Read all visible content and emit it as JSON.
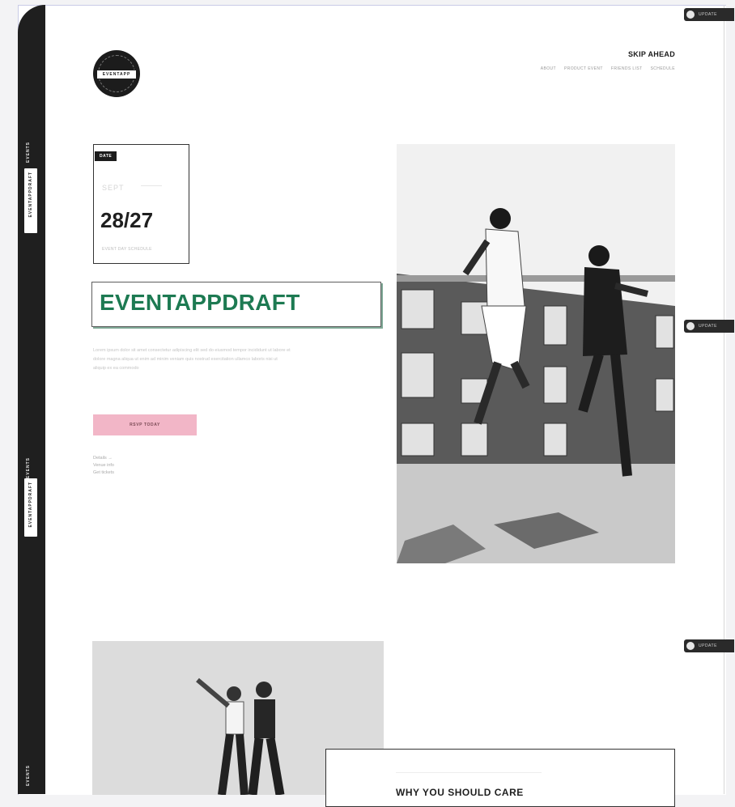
{
  "rail": {
    "vertical_text_top": "EVENTS",
    "vertical_box_top": "EVENTAPPDRAFT",
    "vertical_text_mid": "EVENTS",
    "vertical_box_mid": "EVENTAPPDRAFT",
    "vertical_text_bottom": "EVENTS"
  },
  "logo": {
    "text": "EVENTAPP"
  },
  "header": {
    "skip_label": "SKIP AHEAD",
    "nav": [
      "ABOUT",
      "PRODUCT EVENT",
      "FRIENDS LIST",
      "SCHEDULE"
    ]
  },
  "date_card": {
    "tag": "DATE",
    "pre": "SEPT",
    "date": "28/27",
    "sub": "EVENT DAY SCHEDULE"
  },
  "hero": {
    "title": "EVENTAPPDRAFT",
    "description": "Lorem ipsum dolor sit amet consectetur adipiscing elit sed do eiusmod tempor incididunt ut labore et dolore magna aliqua ut enim ad minim veniam quis nostrud exercitation ullamco laboris nisi ut aliquip ex ea commodo",
    "cta_label": "RSVP TODAY",
    "small_links": [
      "Details →",
      "Venue info",
      "Get tickets"
    ]
  },
  "section2": {
    "heading": "WHY YOU SHOULD CARE"
  },
  "side_tabs": [
    "UPDATE",
    "UPDATE",
    "UPDATE"
  ],
  "colors": {
    "accent_green": "#1d7a52",
    "cta_pink": "#f2b6c7",
    "rail_dark": "#1f1f1f"
  }
}
